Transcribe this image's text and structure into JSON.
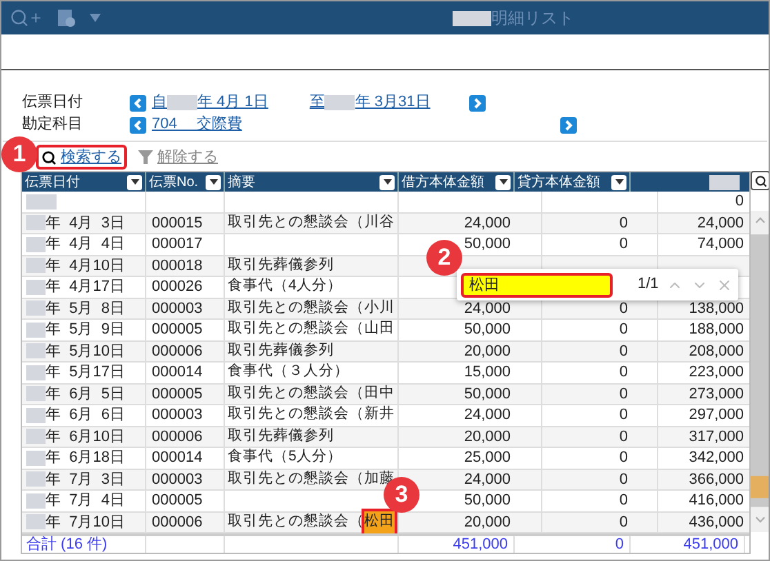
{
  "toolbar": {
    "title": "明細リスト"
  },
  "filters": [
    {
      "label": "伝票日付",
      "parts": [
        "自",
        "年  4月 1日",
        "至",
        "年  3月31日"
      ]
    },
    {
      "label": "勘定科目",
      "parts": [
        "704　 交際費"
      ]
    }
  ],
  "actions": [
    {
      "label": "検索する",
      "kind": "search",
      "highlighted": true
    },
    {
      "label": "解除する",
      "kind": "clear",
      "highlighted": false
    }
  ],
  "table": {
    "columns": [
      "伝票日付",
      "伝票No.",
      "摘要",
      "借方本体金額",
      "貸方本体金額"
    ],
    "rows": [
      {
        "date": "",
        "no": "",
        "summary": "",
        "debit": "",
        "credit": "",
        "balance": "0"
      },
      {
        "date": "年  4月  3日",
        "no": "000015",
        "summary": "取引先との懇談会（川谷",
        "debit": "24,000",
        "credit": "0",
        "balance": "24,000"
      },
      {
        "date": "年  4月  4日",
        "no": "000017",
        "summary": "",
        "debit": "50,000",
        "credit": "0",
        "balance": "74,000"
      },
      {
        "date": "年  4月10日",
        "no": "000018",
        "summary": "取引先葬儀参列",
        "debit": "",
        "credit": "",
        "balance": ""
      },
      {
        "date": "年  4月17日",
        "no": "000026",
        "summary": "食事代（4人分）",
        "debit": "",
        "credit": "",
        "balance": ""
      },
      {
        "date": "年  5月  8日",
        "no": "000003",
        "summary": "取引先との懇談会（小川",
        "debit": "24,000",
        "credit": "0",
        "balance": "138,000"
      },
      {
        "date": "年  5月  9日",
        "no": "000005",
        "summary": "取引先との懇談会（山田",
        "debit": "50,000",
        "credit": "0",
        "balance": "188,000"
      },
      {
        "date": "年  5月10日",
        "no": "000006",
        "summary": "取引先葬儀参列",
        "debit": "20,000",
        "credit": "0",
        "balance": "208,000"
      },
      {
        "date": "年  5月17日",
        "no": "000014",
        "summary": "食事代（３人分）",
        "debit": "15,000",
        "credit": "0",
        "balance": "223,000"
      },
      {
        "date": "年  6月  5日",
        "no": "000005",
        "summary": "取引先との懇談会（田中",
        "debit": "50,000",
        "credit": "0",
        "balance": "273,000"
      },
      {
        "date": "年  6月  6日",
        "no": "000003",
        "summary": "取引先との懇談会（新井",
        "debit": "24,000",
        "credit": "0",
        "balance": "297,000"
      },
      {
        "date": "年  6月10日",
        "no": "000006",
        "summary": "取引先葬儀参列",
        "debit": "20,000",
        "credit": "0",
        "balance": "317,000"
      },
      {
        "date": "年  6月18日",
        "no": "000014",
        "summary": "食事代（5人分）",
        "debit": "25,000",
        "credit": "0",
        "balance": "342,000"
      },
      {
        "date": "年  7月  3日",
        "no": "000003",
        "summary": "取引先との懇談会（加藤",
        "debit": "24,000",
        "credit": "0",
        "balance": "366,000"
      },
      {
        "date": "年  7月  4日",
        "no": "000005",
        "summary": "",
        "debit": "50,000",
        "credit": "0",
        "balance": "416,000"
      },
      {
        "date": "年  7月10日",
        "no": "000006",
        "summary": "取引先との懇談会（",
        "match": "松田",
        "debit": "20,000",
        "credit": "0",
        "balance": "436,000"
      }
    ],
    "total": {
      "label": "合計 (16 件)",
      "debit": "451,000",
      "credit": "0",
      "balance": "451,000"
    }
  },
  "find_bar": {
    "value": "松田",
    "count": "1/1"
  },
  "callouts": [
    "1",
    "2",
    "3"
  ]
}
